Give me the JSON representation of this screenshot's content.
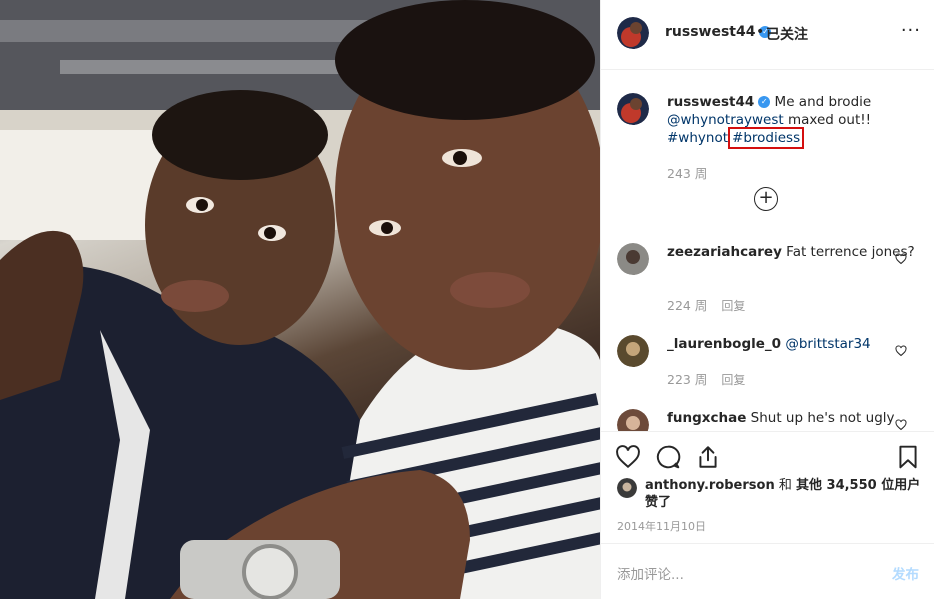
{
  "post": {
    "author": "russwest44",
    "dot": "•",
    "follow_status": "已关注",
    "more": "···"
  },
  "caption": {
    "user": "russwest44",
    "text1": "Me and brodie",
    "mention": "@whynotraywest",
    "text2": "maxed out!!",
    "tag1": "#whynot",
    "tag2": "#brodiess",
    "time": "243 周"
  },
  "load_more": "+",
  "comments": [
    {
      "user": "zeezariahcarey",
      "text": "Fat terrence jones?",
      "time": "224 周",
      "reply": "回复"
    },
    {
      "user": "_laurenbogle_0",
      "text": "@brittstar34",
      "time": "223 周",
      "reply": "回复"
    },
    {
      "user": "fungxchae",
      "text": "Shut up he's not ugly",
      "time": "",
      "reply": ""
    }
  ],
  "likes": {
    "user": "anthony.roberson",
    "and": "和",
    "others": "其他 34,550 位用户",
    "liked": "赞了"
  },
  "date": "2014年11月10日",
  "add_comment": {
    "placeholder": "添加评论...",
    "post": "发布"
  },
  "icons": [
    "heart-icon",
    "comment-icon",
    "share-icon",
    "bookmark-icon",
    "more-icon",
    "verified-icon"
  ],
  "colors": {
    "link": "#003569",
    "verified": "#3897f0",
    "highlight": "#d40f0f",
    "muted": "#999999"
  }
}
